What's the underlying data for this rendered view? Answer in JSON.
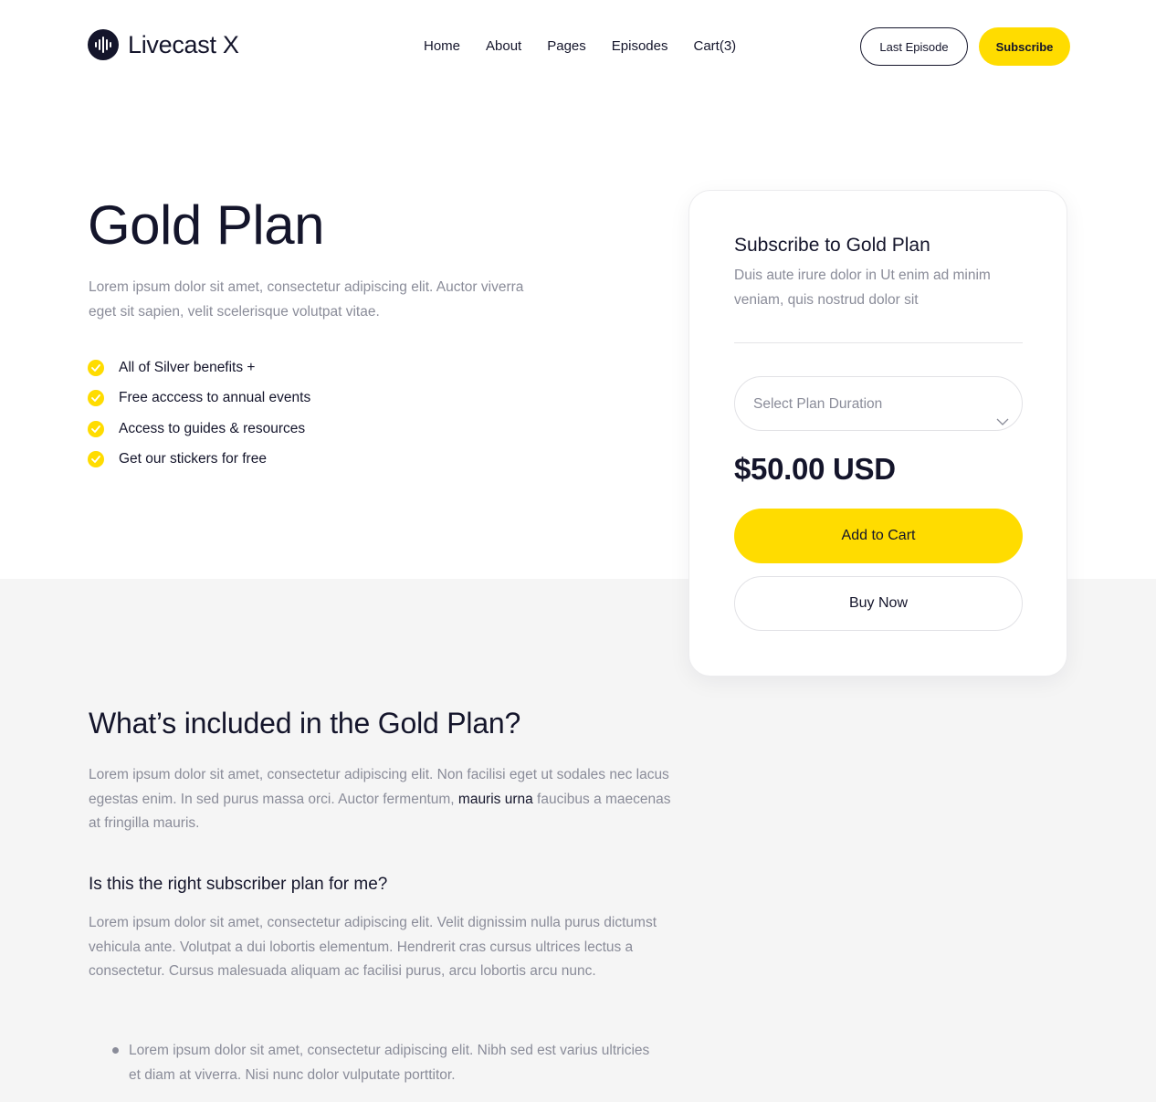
{
  "header": {
    "logo_text": "Livecast X",
    "logo_icon": "soundwave-icon",
    "nav": [
      "Home",
      "About",
      "Pages",
      "Episodes",
      "Cart(3)"
    ],
    "last_episode_label": "Last Episode",
    "subscribe_label": "Subscribe"
  },
  "hero": {
    "title": "Gold Plan",
    "description": "Lorem ipsum dolor sit amet, consectetur adipiscing elit. Auctor viverra eget sit sapien, velit scelerisque volutpat vitae.",
    "benefit_icon": "check-circle-icon",
    "benefits": [
      "All of Silver benefits +",
      "Free acccess to annual events",
      "Access to guides & resources",
      "Get our stickers for free"
    ]
  },
  "card": {
    "title": "Subscribe to Gold Plan",
    "description": "Duis aute irure dolor in Ut enim ad minim veniam, quis nostrud dolor sit",
    "select_placeholder": "Select Plan Duration",
    "price": "$50.00 USD",
    "add_to_cart_label": "Add to Cart",
    "buy_now_label": "Buy Now"
  },
  "content": {
    "heading": "What’s included in the Gold Plan?",
    "paragraph1_start": "Lorem ipsum dolor sit amet, consectetur adipiscing elit. Non facilisi eget ut sodales nec lacus egestas enim. In sed purus massa orci. Auctor fermentum, ",
    "paragraph1_link": "mauris urna",
    "paragraph1_end": " faucibus a maecenas at fringilla mauris.",
    "subheading": "Is this the right subscriber plan for me?",
    "paragraph2": "Lorem ipsum dolor sit amet, consectetur adipiscing elit. Velit dignissim nulla purus dictumst vehicula ante. Volutpat a dui lobortis elementum. Hendrerit cras cursus ultrices lectus a consectetur. Cursus malesuada aliquam ac facilisi purus, arcu lobortis arcu nunc.",
    "bullets": [
      "Lorem ipsum dolor sit amet, consectetur adipiscing elit. Nibh sed est varius ultricies et diam at viverra. Nisi nunc dolor vulputate porttitor."
    ]
  },
  "colors": {
    "accent": "#ffdc00",
    "text_dark": "#14152b",
    "text_muted": "#8a8c99",
    "band_bg": "#f5f5f5"
  }
}
